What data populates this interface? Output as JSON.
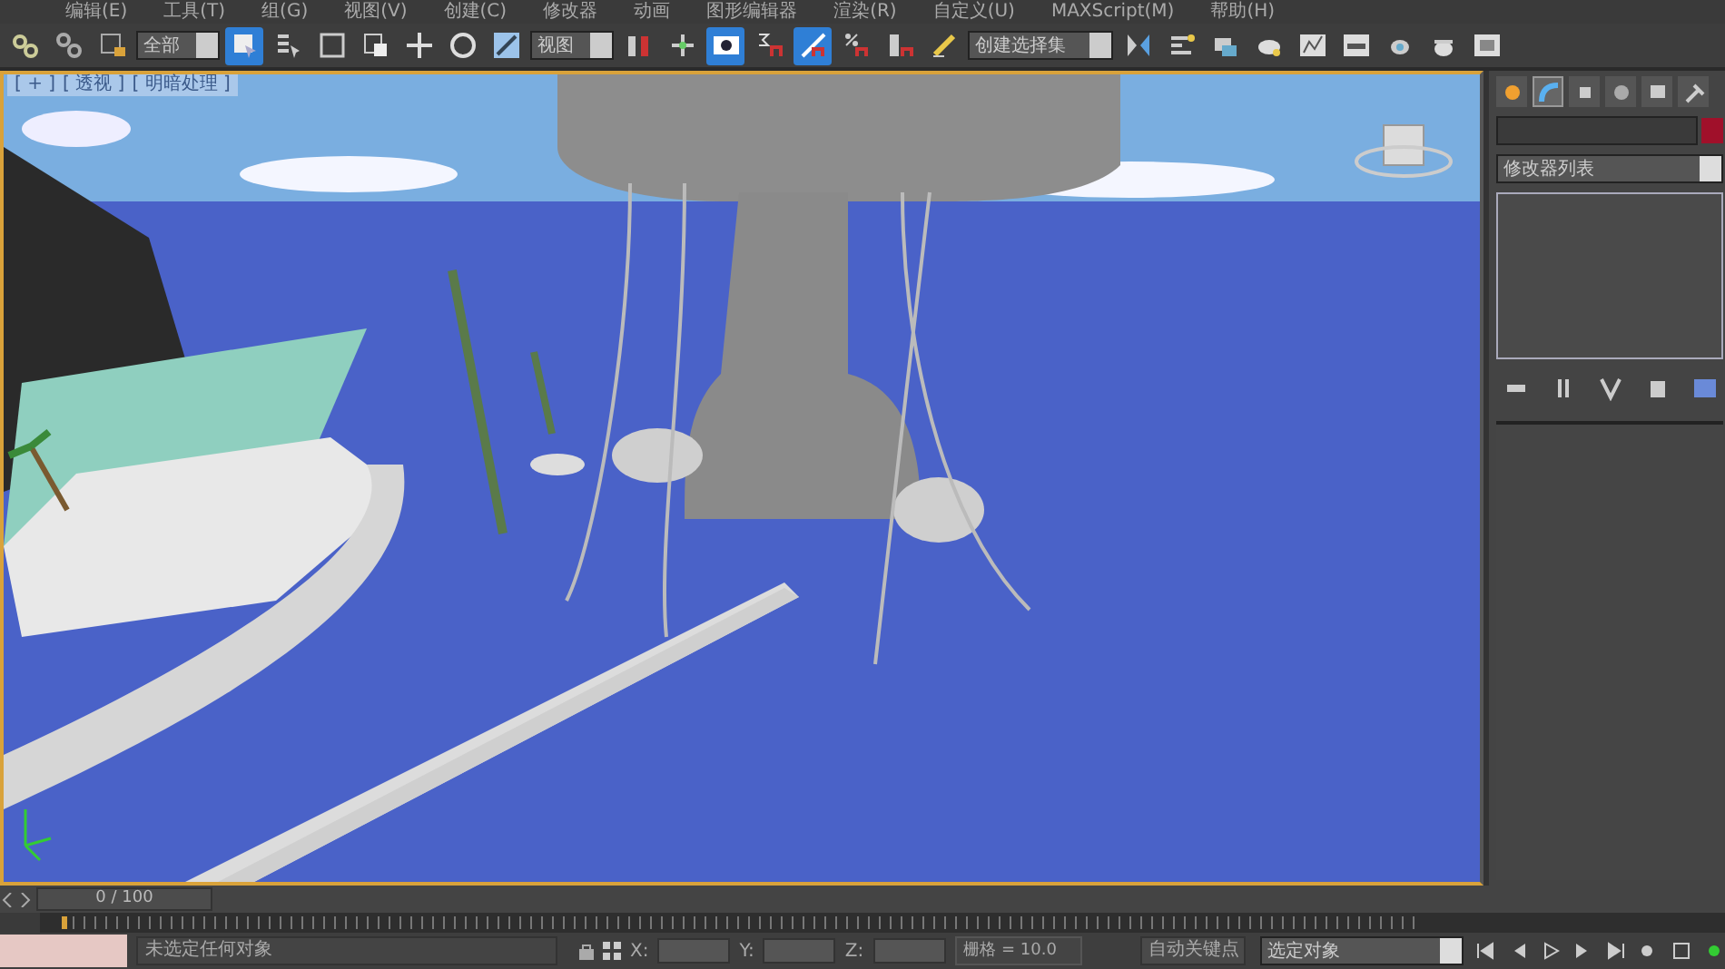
{
  "menu_bar": [
    {
      "label": "编辑(E)"
    },
    {
      "label": "工具(T)"
    },
    {
      "label": "组(G)"
    },
    {
      "label": "视图(V)"
    },
    {
      "label": "创建(C)"
    },
    {
      "label": "修改器"
    },
    {
      "label": "动画"
    },
    {
      "label": "图形编辑器"
    },
    {
      "label": "渲染(R)"
    },
    {
      "label": "自定义(U)"
    },
    {
      "label": "MAXScript(M)"
    },
    {
      "label": "帮助(H)"
    }
  ],
  "toolbar": [
    {
      "kind": "button",
      "selected": false
    },
    {
      "kind": "button",
      "selected": false
    },
    {
      "kind": "button",
      "selected": false
    },
    {
      "kind": "dropdown",
      "value": "全部"
    },
    {
      "kind": "button",
      "selected": true
    },
    {
      "kind": "button",
      "selected": false
    },
    {
      "kind": "button",
      "selected": false
    },
    {
      "kind": "button",
      "selected": false
    },
    {
      "kind": "button",
      "selected": false
    },
    {
      "kind": "button",
      "selected": false
    },
    {
      "kind": "button",
      "selected": false
    },
    {
      "kind": "dropdown",
      "value": "视图"
    },
    {
      "kind": "button",
      "selected": false
    },
    {
      "kind": "button",
      "selected": false
    },
    {
      "kind": "button",
      "selected": true
    },
    {
      "kind": "button",
      "selected": false
    },
    {
      "kind": "button",
      "selected": true
    },
    {
      "kind": "button",
      "selected": false
    },
    {
      "kind": "button",
      "selected": false
    },
    {
      "kind": "button",
      "selected": false
    },
    {
      "kind": "dropdown",
      "value": "创建选择集"
    },
    {
      "kind": "button",
      "selected": false
    },
    {
      "kind": "button",
      "selected": false
    },
    {
      "kind": "button",
      "selected": false
    },
    {
      "kind": "button",
      "selected": false
    },
    {
      "kind": "button",
      "selected": false
    },
    {
      "kind": "button",
      "selected": false
    },
    {
      "kind": "button",
      "selected": false
    },
    {
      "kind": "button",
      "selected": false
    },
    {
      "kind": "button",
      "selected": false
    }
  ],
  "viewport": {
    "labels": [
      {
        "label": "[ + ]"
      },
      {
        "label": "[ 透视 ]"
      },
      {
        "label": "[ 明暗处理 ]"
      }
    ]
  },
  "command_panel": {
    "tabs": [
      {
        "selected": false
      },
      {
        "selected": true
      },
      {
        "selected": false
      },
      {
        "selected": false
      },
      {
        "selected": false
      },
      {
        "selected": false
      }
    ],
    "modifier_list": {
      "value": "修改器列表"
    }
  },
  "timeline": {
    "frame": "0 / 100"
  },
  "status_bar": {
    "prompt": "未选定任何对象",
    "x_label": "X:",
    "y_label": "Y:",
    "z_label": "Z:",
    "grid": "栅格 = 10.0",
    "auto_key": "自动关键点",
    "key_filter": "选定对象"
  }
}
